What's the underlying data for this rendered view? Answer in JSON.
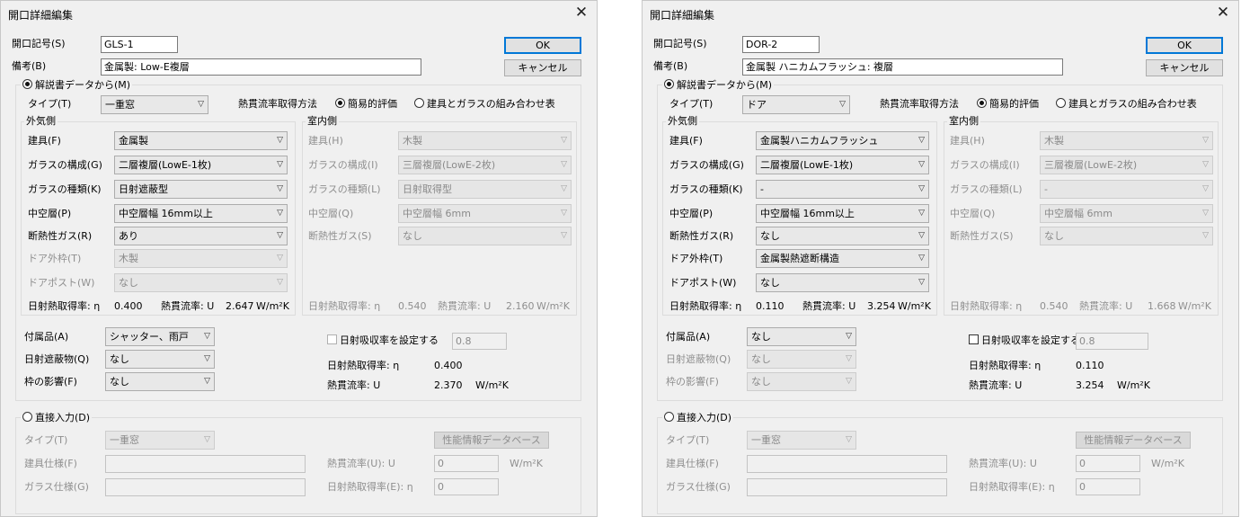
{
  "labels": {
    "title": "開口詳細編集",
    "code": "開口記号(S)",
    "note": "備考(B)",
    "ok": "OK",
    "cancel": "キャンセル",
    "from_doc": "解説書データから(M)",
    "type": "タイプ(T)",
    "method": "熱貫流率取得方法",
    "simple": "簡易的評価",
    "combo": "建具とガラスの組み合わせ表",
    "outdoor": "外気側",
    "indoor": "室内側",
    "frame_o": "建具(F)",
    "glass_comp_o": "ガラスの構成(G)",
    "glass_type_o": "ガラスの種類(K)",
    "air_o": "中空層(P)",
    "gas_o": "断熱性ガス(R)",
    "door_frame": "ドア外枠(T)",
    "door_post": "ドアポスト(W)",
    "frame_i": "建具(H)",
    "glass_comp_i": "ガラスの構成(I)",
    "glass_type_i": "ガラスの種類(L)",
    "air_i": "中空層(Q)",
    "gas_i": "断熱性ガス(S)",
    "eta": "日射熱取得率: η",
    "u": "熱貫流率: U",
    "unit": "W/m²K",
    "accessory": "付属品(A)",
    "shade": "日射遮蔽物(Q)",
    "frame_effect": "枠の影響(F)",
    "absorb": "日射吸収率を設定する",
    "eta_total": "日射熱取得率: η",
    "u_total": "熱貫流率: U",
    "direct": "直接入力(D)",
    "type2": "タイプ(T)",
    "spec_frame": "建具仕様(F)",
    "spec_glass": "ガラス仕様(G)",
    "db": "性能情報データベース",
    "u_in": "熱貫流率(U): U",
    "eta_in": "日射熱取得率(E): η"
  },
  "dialogs": [
    {
      "code": "GLS-1",
      "note": "金属製: Low-E複層",
      "type": "一重窓",
      "out": {
        "frame": "金属製",
        "glass_comp": "二層複層(LowE-1枚)",
        "glass_type": "日射遮蔽型",
        "air": "中空層幅 16mm以上",
        "gas": "あり",
        "door_frame": "木製",
        "door_post": "なし",
        "eta": "0.400",
        "u": "2.647"
      },
      "in": {
        "frame": "木製",
        "glass_comp": "三層複層(LowE-2枚)",
        "glass_type": "日射取得型",
        "air": "中空層幅 6mm",
        "gas": "なし",
        "eta": "0.540",
        "u": "2.160"
      },
      "accessory": "シャッター、雨戸",
      "shade": "なし",
      "frame_effect": "なし",
      "absorb_value": "0.8",
      "eta_total": "0.400",
      "u_total": "2.370",
      "direct": {
        "type": "一重窓",
        "spec_frame": "",
        "spec_glass": "",
        "u": "0",
        "eta": "0"
      }
    },
    {
      "code": "DOR-2",
      "note": "金属製 ハニカムフラッシュ: 複層",
      "type": "ドア",
      "out": {
        "frame": "金属製ハニカムフラッシュ",
        "glass_comp": "二層複層(LowE-1枚)",
        "glass_type": "-",
        "air": "中空層幅 16mm以上",
        "gas": "なし",
        "door_frame": "金属製熱遮断構造",
        "door_post": "なし",
        "eta": "0.110",
        "u": "3.254"
      },
      "in": {
        "frame": "木製",
        "glass_comp": "三層複層(LowE-2枚)",
        "glass_type": "-",
        "air": "中空層幅 6mm",
        "gas": "なし",
        "eta": "0.540",
        "u": "1.668"
      },
      "accessory": "なし",
      "shade": "なし",
      "frame_effect": "なし",
      "absorb_value": "0.8",
      "eta_total": "0.110",
      "u_total": "3.254",
      "direct": {
        "type": "一重窓",
        "spec_frame": "",
        "spec_glass": "",
        "u": "0",
        "eta": "0"
      }
    }
  ],
  "icons": {
    "close": "close-icon",
    "dropdown": "chevron-down-icon",
    "radio": "radio-button",
    "checkbox": "checkbox"
  }
}
